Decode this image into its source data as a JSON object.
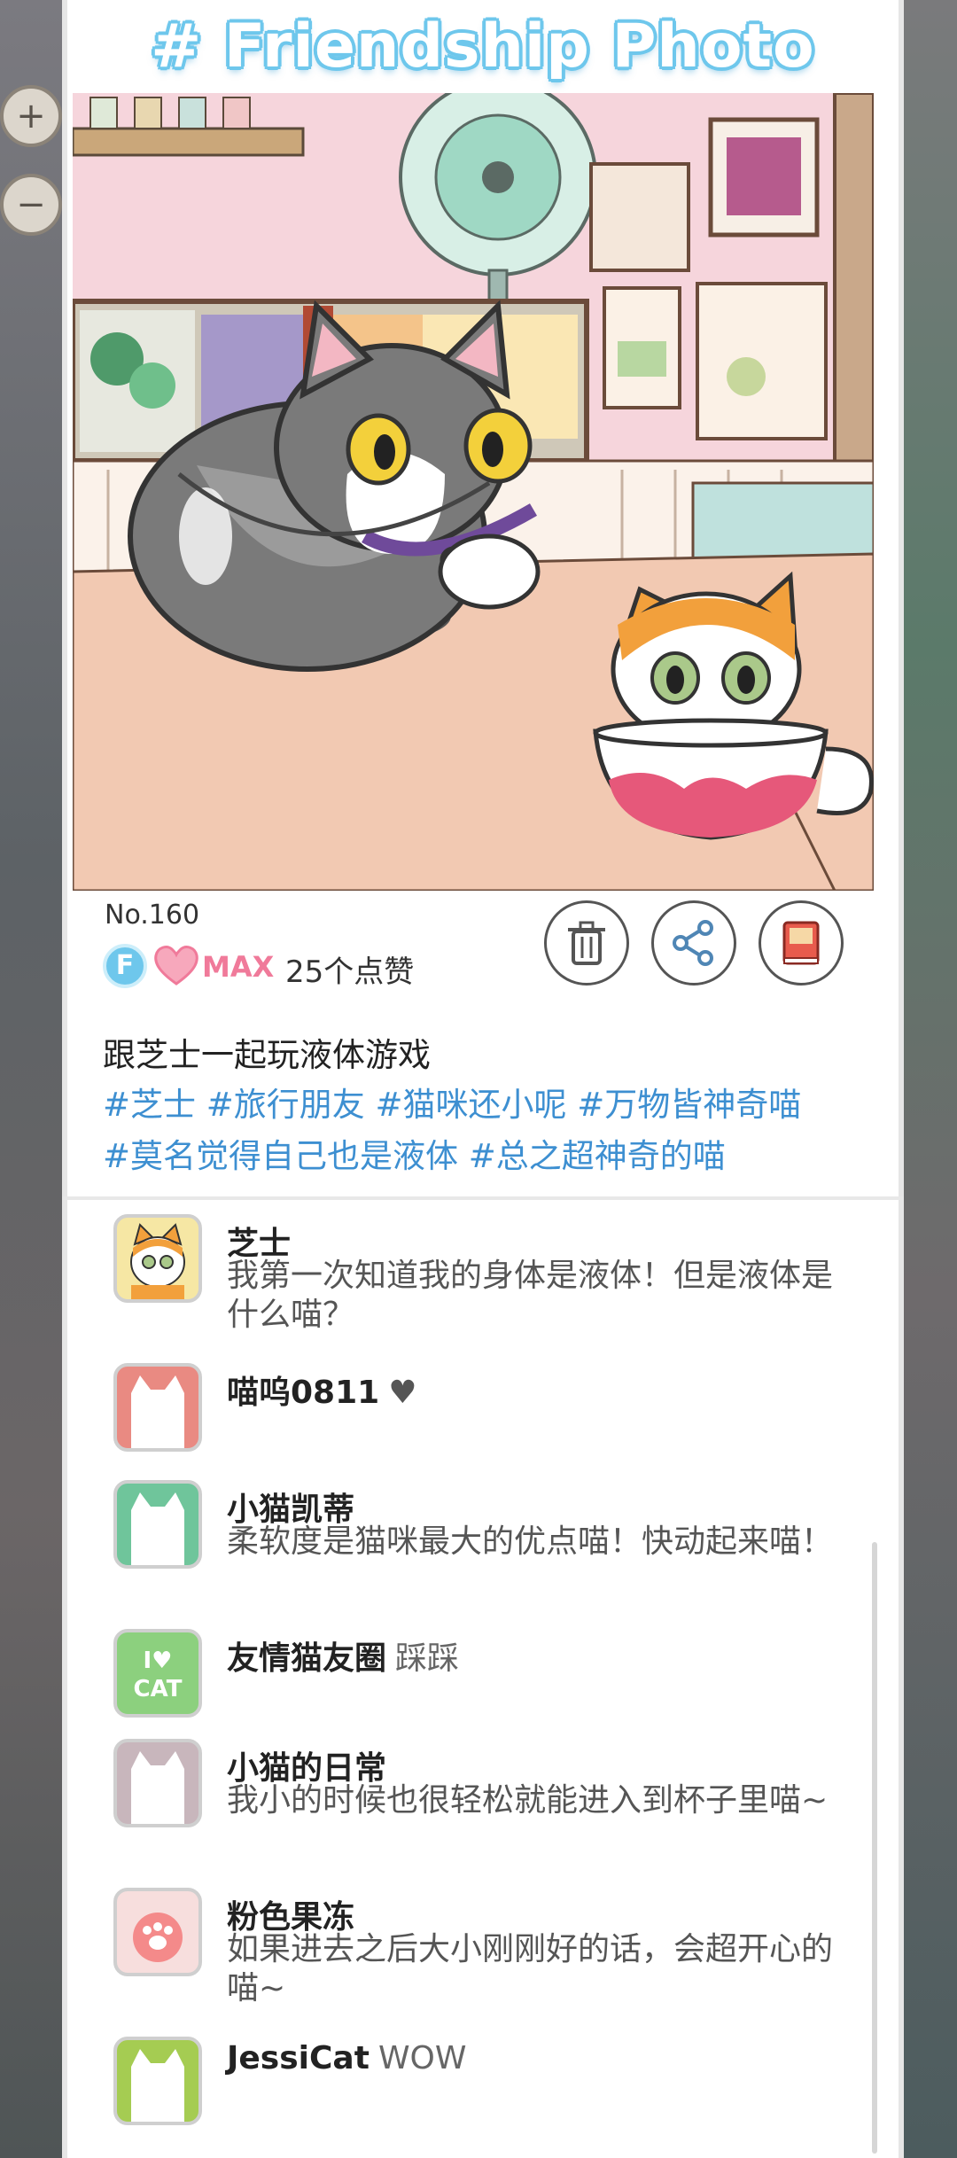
{
  "header": {
    "title": "# Friendship Photo"
  },
  "photo": {
    "number": "No.160",
    "badge_letter": "F",
    "max_label": "MAX",
    "likes": "25个点赞"
  },
  "actions": [
    {
      "name": "delete-button",
      "icon": "trash-icon"
    },
    {
      "name": "share-button",
      "icon": "share-icon"
    },
    {
      "name": "album-button",
      "icon": "book-icon"
    }
  ],
  "post": {
    "caption": "跟芝士一起玩液体游戏",
    "tags_line1": "#芝士 #旅行朋友 #猫咪还小呢 #万物皆神奇喵",
    "tags_line2": "#莫名觉得自己也是液体 #总之超神奇的喵"
  },
  "comments": [
    {
      "name": "芝士",
      "text": "我第一次知道我的身体是液体！但是液体是什么喵？",
      "inline": ""
    },
    {
      "name": "喵呜0811",
      "text": "",
      "inline": "♥"
    },
    {
      "name": "小猫凯蒂",
      "text": "柔软度是猫咪最大的优点喵！快动起来喵！",
      "inline": ""
    },
    {
      "name": "友情猫友圈",
      "text": "",
      "inline": "踩踩",
      "avatar_text": "I♥ CAT"
    },
    {
      "name": "小猫的日常",
      "text": "我小的时候也很轻松就能进入到杯子里喵~",
      "inline": ""
    },
    {
      "name": "粉色果冻",
      "text": "如果进去之后大小刚刚好的话，会超开心的喵~",
      "inline": ""
    },
    {
      "name": "JessiCat",
      "text": "",
      "inline": "WOW"
    }
  ],
  "map_controls": {
    "zoom_in": "+",
    "zoom_out": "−"
  },
  "colors": {
    "title_outline": "#6ec7ec",
    "tag_blue": "#3d8fd1",
    "heart_pink": "#f07a9a",
    "avatar_colors": [
      "#f6e7a4",
      "#e98a82",
      "#6fc59b",
      "#8cd07e",
      "#c8b6bc",
      "#f7dedd",
      "#a5cc52"
    ]
  }
}
